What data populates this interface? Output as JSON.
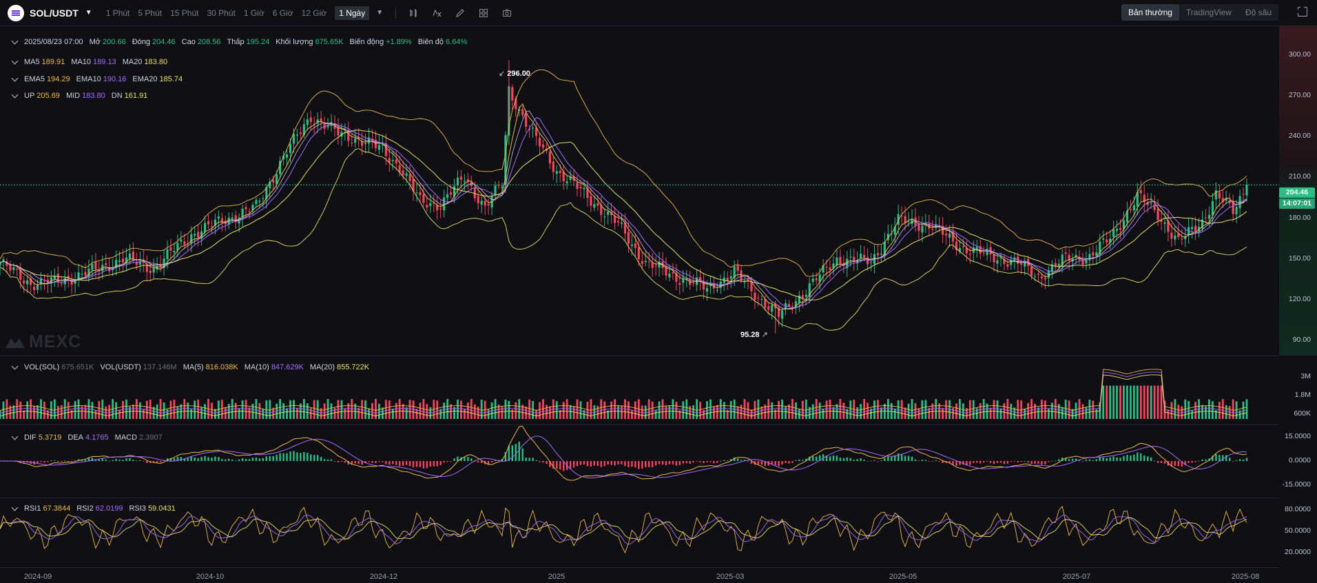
{
  "toolbar": {
    "symbol": "SOL/USDT",
    "timeframes": [
      "1 Phút",
      "5 Phút",
      "15 Phút",
      "30 Phút",
      "1 Giờ",
      "6 Giờ",
      "12 Giờ",
      "1 Ngày"
    ],
    "active_timeframe": "1 Ngày",
    "views": [
      "Bản thường",
      "TradingView",
      "Độ sâu"
    ],
    "active_view": "Bản thường",
    "icons": [
      "candle-type-icon",
      "indicator-icon",
      "draw-icon",
      "layout-icon",
      "camera-icon",
      "fullscreen-icon"
    ]
  },
  "ohlc_legend": {
    "date": "2025/08/23 07:00",
    "open_label": "Mở",
    "open": "200.66",
    "close_label": "Đóng",
    "close": "204.46",
    "high_label": "Cao",
    "high": "208.56",
    "low_label": "Thấp",
    "low": "195.24",
    "volume_label": "Khối lượng",
    "volume": "675.65K",
    "change_label": "Biến động",
    "change": "+1.89%",
    "amp_label": "Biên độ",
    "amp": "6.64%"
  },
  "ma_legend": {
    "ma5_label": "MA5",
    "ma5": "189.91",
    "ma10_label": "MA10",
    "ma10": "189.13",
    "ma20_label": "MA20",
    "ma20": "183.80"
  },
  "ema_legend": {
    "ema5_label": "EMA5",
    "ema5": "194.29",
    "ema10_label": "EMA10",
    "ema10": "190.16",
    "ema20_label": "EMA20",
    "ema20": "185.74"
  },
  "boll_legend": {
    "up_label": "UP",
    "up": "205.69",
    "mid_label": "MID",
    "mid": "183.80",
    "dn_label": "DN",
    "dn": "161.91"
  },
  "vol_legend": {
    "vol_label": "VOL(SOL)",
    "vol": "675.651K",
    "volu_label": "VOL(USDT)",
    "volu": "137.146M",
    "ma5_label": "MA(5)",
    "ma5": "816.038K",
    "ma10_label": "MA(10)",
    "ma10": "847.629K",
    "ma20_label": "MA(20)",
    "ma20": "855.722K"
  },
  "macd_legend": {
    "dif_label": "DIF",
    "dif": "5.3719",
    "dea_label": "DEA",
    "dea": "4.1765",
    "macd_label": "MACD",
    "macd": "2.3907"
  },
  "rsi_legend": {
    "rsi1_label": "RSI1",
    "rsi1": "67.3844",
    "rsi2_label": "RSI2",
    "rsi2": "62.0199",
    "rsi3_label": "RSI3",
    "rsi3": "59.0431"
  },
  "price_axis": [
    "300.00",
    "270.00",
    "240.00",
    "210.00",
    "180.00",
    "150.00",
    "120.00",
    "90.00"
  ],
  "vol_axis": [
    "3M",
    "1.8M",
    "600K"
  ],
  "macd_axis": [
    "15.0000",
    "0.0000",
    "-15.0000"
  ],
  "rsi_axis": [
    "80.0000",
    "50.0000",
    "20.0000"
  ],
  "last_price": "204.46",
  "countdown": "14:07:01",
  "annotations": {
    "high": "296.00",
    "low": "95.28"
  },
  "watermark": "MEXC",
  "dates": [
    "2024-09",
    "2024-10",
    "2024-12",
    "2025",
    "2025-03",
    "2025-05",
    "2025-07",
    "2025-08"
  ],
  "colors": {
    "up": "#2ebd85",
    "down": "#f6465d",
    "ma5": "#f0b84b",
    "ma10": "#a66bff",
    "ma20": "#e9e067",
    "boll": "#f0b84b",
    "bg": "#101014"
  },
  "chart_data": {
    "type": "candlestick",
    "interval": "1 Ngày",
    "close_path": [
      [
        "2024-08-23",
        147
      ],
      [
        "2024-09-01",
        132
      ],
      [
        "2024-09-08",
        133
      ],
      [
        "2024-09-18",
        140
      ],
      [
        "2024-09-28",
        150
      ],
      [
        "2024-10-07",
        143
      ],
      [
        "2024-10-18",
        168
      ],
      [
        "2024-10-27",
        178
      ],
      [
        "2024-11-06",
        188
      ],
      [
        "2024-11-14",
        225
      ],
      [
        "2024-11-22",
        255
      ],
      [
        "2024-11-30",
        242
      ],
      [
        "2024-12-06",
        238
      ],
      [
        "2024-12-13",
        230
      ],
      [
        "2024-12-18",
        218
      ],
      [
        "2024-12-24",
        192
      ],
      [
        "2024-12-30",
        190
      ],
      [
        "2025-01-06",
        210
      ],
      [
        "2025-01-12",
        188
      ],
      [
        "2025-01-17",
        205
      ],
      [
        "2025-01-19",
        275
      ],
      [
        "2025-01-25",
        245
      ],
      [
        "2025-02-02",
        215
      ],
      [
        "2025-02-10",
        198
      ],
      [
        "2025-02-20",
        175
      ],
      [
        "2025-02-28",
        147
      ],
      [
        "2025-03-08",
        138
      ],
      [
        "2025-03-18",
        128
      ],
      [
        "2025-03-26",
        140
      ],
      [
        "2025-04-03",
        120
      ],
      [
        "2025-04-08",
        108
      ],
      [
        "2025-04-15",
        125
      ],
      [
        "2025-04-25",
        150
      ],
      [
        "2025-05-05",
        148
      ],
      [
        "2025-05-13",
        178
      ],
      [
        "2025-05-22",
        175
      ],
      [
        "2025-06-01",
        158
      ],
      [
        "2025-06-09",
        152
      ],
      [
        "2025-06-17",
        147
      ],
      [
        "2025-06-23",
        137
      ],
      [
        "2025-07-01",
        150
      ],
      [
        "2025-07-08",
        152
      ],
      [
        "2025-07-14",
        165
      ],
      [
        "2025-07-22",
        196
      ],
      [
        "2025-07-28",
        183
      ],
      [
        "2025-08-03",
        162
      ],
      [
        "2025-08-10",
        178
      ],
      [
        "2025-08-14",
        197
      ],
      [
        "2025-08-19",
        185
      ],
      [
        "2025-08-23",
        204.46
      ]
    ],
    "last_candle": {
      "date": "2025/08/23",
      "open": 200.66,
      "high": 208.56,
      "low": 195.24,
      "close": 204.46,
      "volume": "675.65K"
    },
    "ylim": [
      80,
      320
    ],
    "extremes": {
      "high": 296.0,
      "low": 95.28
    }
  }
}
